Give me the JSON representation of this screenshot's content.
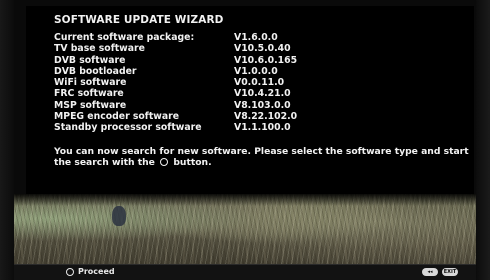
{
  "wizard": {
    "title": "SOFTWARE UPDATE WIZARD",
    "rows": [
      {
        "label": "Current software package:",
        "value": "V1.6.0.0"
      },
      {
        "label": "TV base software",
        "value": "V10.5.0.40"
      },
      {
        "label": "DVB software",
        "value": "V10.6.0.165"
      },
      {
        "label": "DVB bootloader",
        "value": "V1.0.0.0"
      },
      {
        "label": "WiFi software",
        "value": "V0.0.11.0"
      },
      {
        "label": "FRC software",
        "value": "V10.4.21.0"
      },
      {
        "label": "MSP software",
        "value": "V8.103.0.0"
      },
      {
        "label": "MPEG encoder software",
        "value": "V8.22.102.0"
      },
      {
        "label": "Standby processor software",
        "value": "V1.1.100.0"
      }
    ],
    "message_part1": "You can now search for new software. Please select the software type and start the search with the",
    "message_icon": "ok-circle-icon",
    "message_part2": "button."
  },
  "footer": {
    "proceed_icon": "ok-circle-icon",
    "proceed_label": "Proceed",
    "key_icons": [
      "back-key-icon",
      "exit-key-icon"
    ],
    "key_labels": [
      "◂◂",
      "EXIT"
    ]
  },
  "colors": {
    "background": "#000000",
    "text": "#f2f2f2",
    "footer_bg": "#121212"
  }
}
